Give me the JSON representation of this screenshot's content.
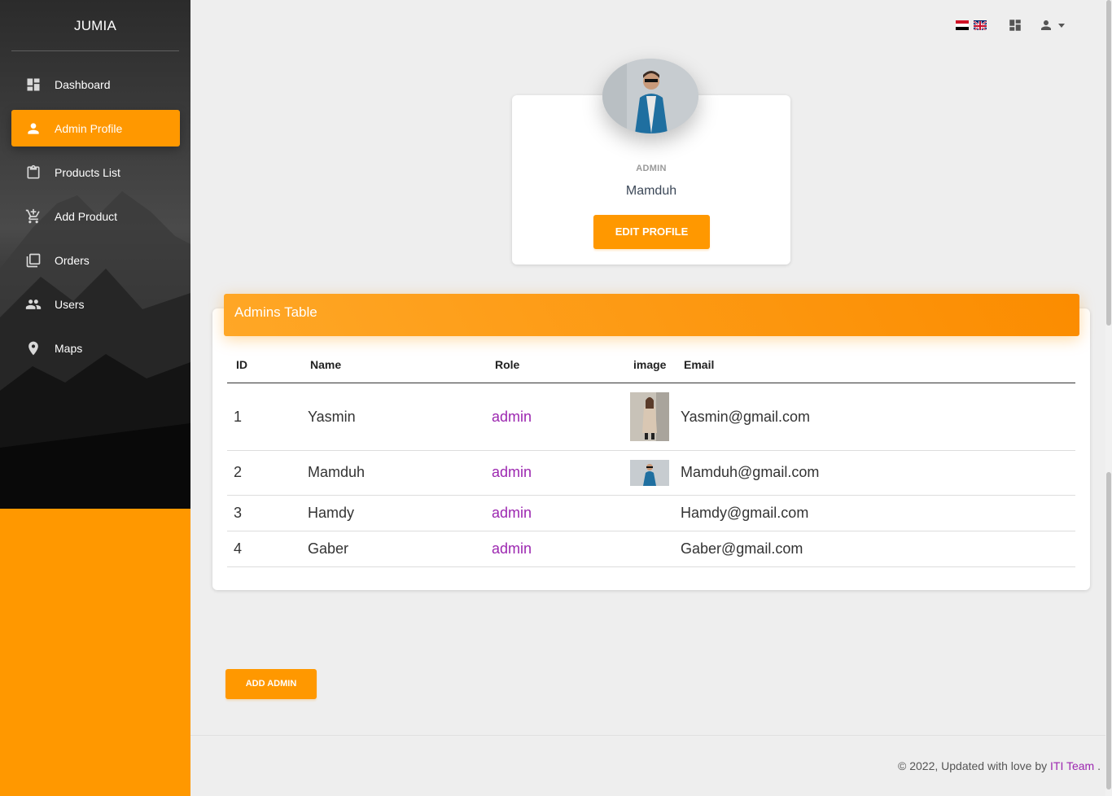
{
  "brand": "JUMIA",
  "sidebar": {
    "items": [
      {
        "label": "Dashboard",
        "icon": "dashboard-icon",
        "active": false
      },
      {
        "label": "Admin Profile",
        "icon": "person-icon",
        "active": true
      },
      {
        "label": "Products List",
        "icon": "clipboard-icon",
        "active": false
      },
      {
        "label": "Add Product",
        "icon": "add-shopping-cart-icon",
        "active": false
      },
      {
        "label": "Orders",
        "icon": "library-books-icon",
        "active": false
      },
      {
        "label": "Users",
        "icon": "people-icon",
        "active": false
      },
      {
        "label": "Maps",
        "icon": "location-pin-icon",
        "active": false
      }
    ]
  },
  "topnav": {
    "flags": [
      "egypt-flag-icon",
      "uk-flag-icon"
    ],
    "icons": [
      "dashboard-icon",
      "person-icon"
    ]
  },
  "profile": {
    "role": "ADMIN",
    "name": "Mamduh",
    "edit_label": "EDIT PROFILE"
  },
  "admins_table": {
    "title": "Admins Table",
    "columns": [
      "ID",
      "Name",
      "Role",
      "image",
      "Email"
    ],
    "rows": [
      {
        "id": "1",
        "name": "Yasmin",
        "role": "admin",
        "has_image": true,
        "email": "Yasmin@gmail.com"
      },
      {
        "id": "2",
        "name": "Mamduh",
        "role": "admin",
        "has_image": true,
        "email": "Mamduh@gmail.com"
      },
      {
        "id": "3",
        "name": "Hamdy",
        "role": "admin",
        "has_image": false,
        "email": "Hamdy@gmail.com"
      },
      {
        "id": "4",
        "name": "Gaber",
        "role": "admin",
        "has_image": false,
        "email": "Gaber@gmail.com"
      }
    ]
  },
  "add_admin_label": "ADD ADMIN",
  "footer": {
    "text": "© 2022, Updated with love by",
    "team": "ITI Team",
    "suffix": "."
  },
  "colors": {
    "accent": "#ff9800",
    "link": "#9c27b0",
    "background": "#eeeeee"
  }
}
